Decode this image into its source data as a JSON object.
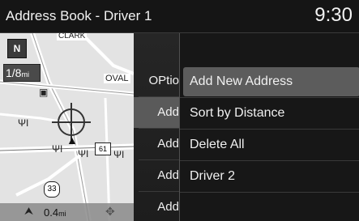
{
  "header": {
    "title": "Address Book - Driver 1",
    "clock": "9:30"
  },
  "map": {
    "north_label": "N",
    "scale_value": "1/8",
    "scale_unit": "mi",
    "street_clark": "CLARK",
    "street_oval": "OVAL",
    "route_61": "61",
    "shield_33": "33",
    "distance_value": "0.4",
    "distance_unit": "mi"
  },
  "middle_menu": {
    "items": [
      {
        "label": "OPtio"
      },
      {
        "label": "Add"
      },
      {
        "label": "Add"
      },
      {
        "label": "Add"
      },
      {
        "label": "Add"
      }
    ]
  },
  "options_menu": {
    "items": [
      {
        "label": "Add New Address"
      },
      {
        "label": "Sort by Distance"
      },
      {
        "label": "Delete All"
      },
      {
        "label": "Driver 2"
      }
    ]
  },
  "icons": [
    "north-arrow-icon",
    "restaurant-icon",
    "parking-icon",
    "vehicle-position-icon",
    "scroll-icon",
    "navigation-arrow-icon"
  ]
}
